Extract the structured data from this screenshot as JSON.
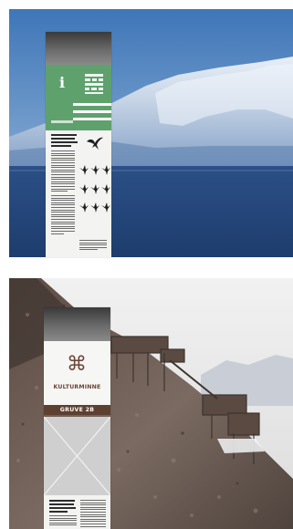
{
  "signs": {
    "top": {
      "info_letter": "i",
      "accent_color": "#5fa16d",
      "icon": "info-icon"
    },
    "bottom": {
      "symbol": "⌘",
      "title": "KULTURMINNE",
      "band_label": "GRUVE 2B",
      "accent_color": "#5e4031",
      "icon": "place-of-interest-icon"
    }
  }
}
